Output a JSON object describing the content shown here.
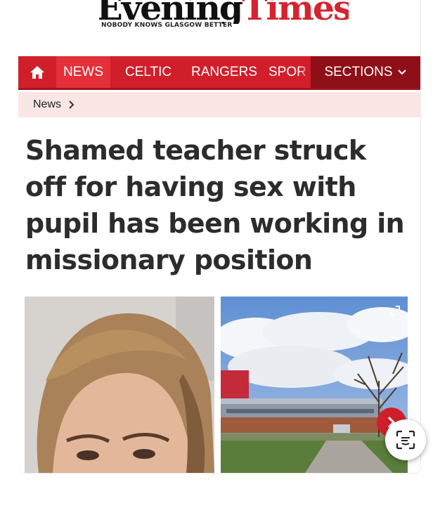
{
  "masthead": {
    "logo_part1": "Evening",
    "logo_part2": "Times",
    "tagline": "NOBODY KNOWS GLASGOW BETTER"
  },
  "nav": {
    "items": [
      {
        "label": "NEWS",
        "active": true
      },
      {
        "label": "CELTIC",
        "active": false
      },
      {
        "label": "RANGERS",
        "active": false
      },
      {
        "label": "SPOR",
        "active": false
      }
    ],
    "sections_label": "SECTIONS"
  },
  "breadcrumb": {
    "label": "News"
  },
  "article": {
    "headline": "Shamed teacher struck off for having sex with pupil has been working in missionary position"
  },
  "colors": {
    "brand_red": "#d01f2b",
    "dark_red": "#8e0f17",
    "breadcrumb_bg": "#fbe6e6"
  },
  "icons": [
    "home-icon",
    "chevron-down-icon",
    "chevron-right-icon",
    "expand-icon",
    "next-arrow-icon",
    "visual-lookup-icon"
  ]
}
